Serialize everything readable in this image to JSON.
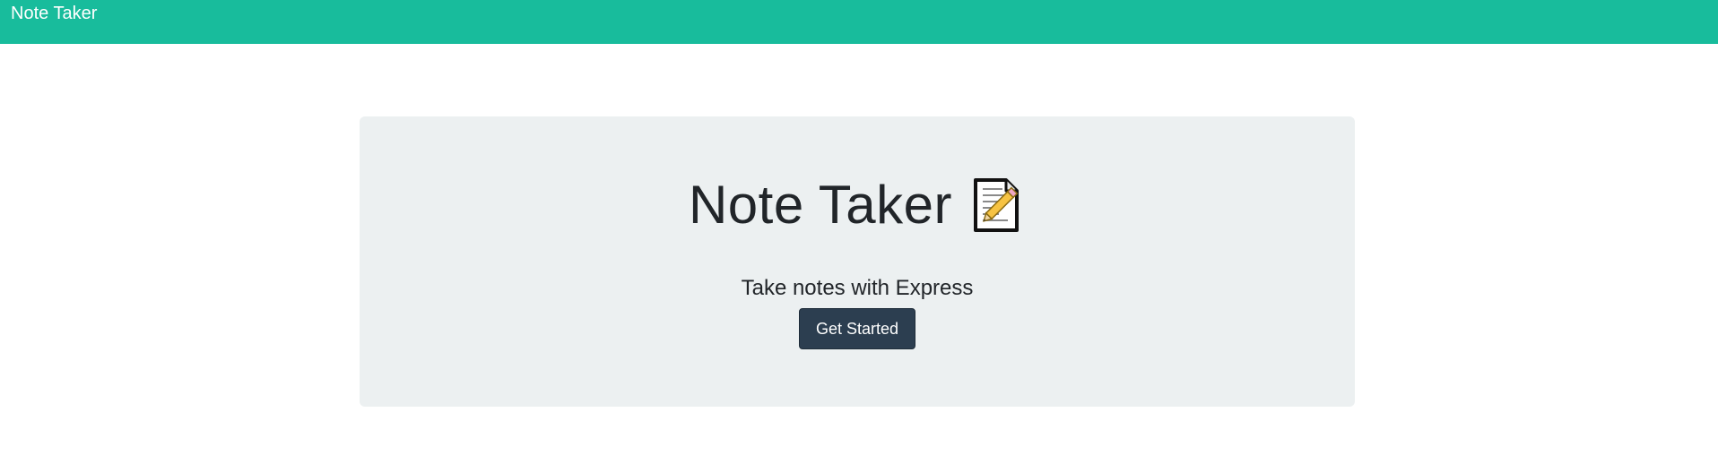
{
  "navbar": {
    "brand": "Note Taker",
    "background_color": "#18bc9c"
  },
  "hero": {
    "title": "Note Taker",
    "title_icon": "memo-icon",
    "subtitle": "Take notes with Express",
    "button_label": "Get Started",
    "panel_color": "#ecf0f1",
    "button_color": "#2c3e50"
  }
}
